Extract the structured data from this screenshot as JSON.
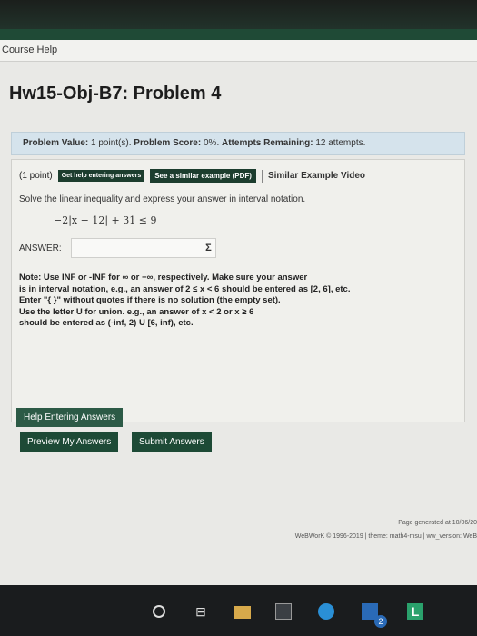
{
  "header": {
    "course_help": "Course Help"
  },
  "title": "Hw15-Obj-B7: Problem 4",
  "status": {
    "problem_value_label": "Problem Value:",
    "problem_value": "1 point(s).",
    "problem_score_label": "Problem Score:",
    "problem_score": "0%.",
    "attempts_label": "Attempts Remaining:",
    "attempts": "12 attempts."
  },
  "problem": {
    "points": "(1 point)",
    "help_entering_pill": "Get help entering answers",
    "similar_example_pill": "See a similar example (PDF)",
    "similar_video": "Similar Example Video",
    "instruction": "Solve the linear inequality and express your answer in interval notation.",
    "formula": "−2|x − 12| + 31 ≤ 9",
    "answer_label": "ANSWER:",
    "answer_value": "",
    "sigma_icon": "Σ",
    "note_lines": [
      "Note: Use INF or -INF for ∞ or −∞, respectively. Make sure your answer",
      "is in interval notation, e.g., an answer of 2 ≤ x < 6 should be entered as [2, 6], etc.",
      "Enter \"{ }\" without quotes if there is no solution (the empty set).",
      "Use the letter U for union. e.g., an answer of x < 2 or x ≥ 6",
      "should be entered as (-inf, 2) U [6, inf), etc."
    ]
  },
  "buttons": {
    "help_entering": "Help Entering Answers",
    "preview": "Preview My Answers",
    "submit": "Submit Answers"
  },
  "footer": {
    "generated": "Page generated at 10/06/20",
    "copyright": "WeBWorK © 1996-2019 | theme: math4-msu | ww_version: WeB"
  },
  "taskbar": {
    "icons": [
      "search-circle-icon",
      "task-view-icon",
      "file-explorer-icon",
      "store-icon",
      "edge-icon",
      "mail-icon",
      "l-app-icon"
    ],
    "mail_badge": "2",
    "l_label": "L"
  }
}
